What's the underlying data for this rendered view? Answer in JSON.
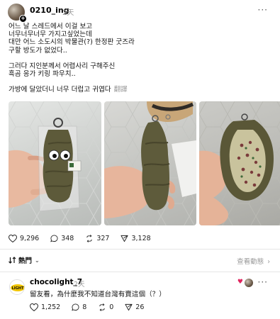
{
  "post": {
    "username": "0210_ing",
    "time": "2天",
    "lines": [
      "어느 날 스레드에서 이걸 보고",
      "너무너무너무 가지고싶었는데",
      "대만 어느 소도시의 박물관(?) 한정판 굿즈라",
      "구할 방도가 없었다..",
      "그러다 지인분께서 어렵사리 구해주신",
      "흑곰 응가 키링 파우치..",
      "가방에 달았더니 너무 더럽고 귀엽다"
    ],
    "translate_label": "翻譯",
    "likes": "9,296",
    "comments": "348",
    "reposts": "327",
    "shares": "3,128"
  },
  "sort": {
    "label": "熱門",
    "view_activity": "查看動態"
  },
  "reply": {
    "username": "chocolight_7",
    "time": "2天",
    "avatar_text": "LIGHT",
    "text": "留友看，為什麼我不知道台灣有賣這個（？）",
    "likes": "1,252",
    "comments": "8",
    "reposts": "0",
    "shares": "26"
  },
  "colors": {
    "accent_like": "#e0245e",
    "muted": "#999999"
  }
}
